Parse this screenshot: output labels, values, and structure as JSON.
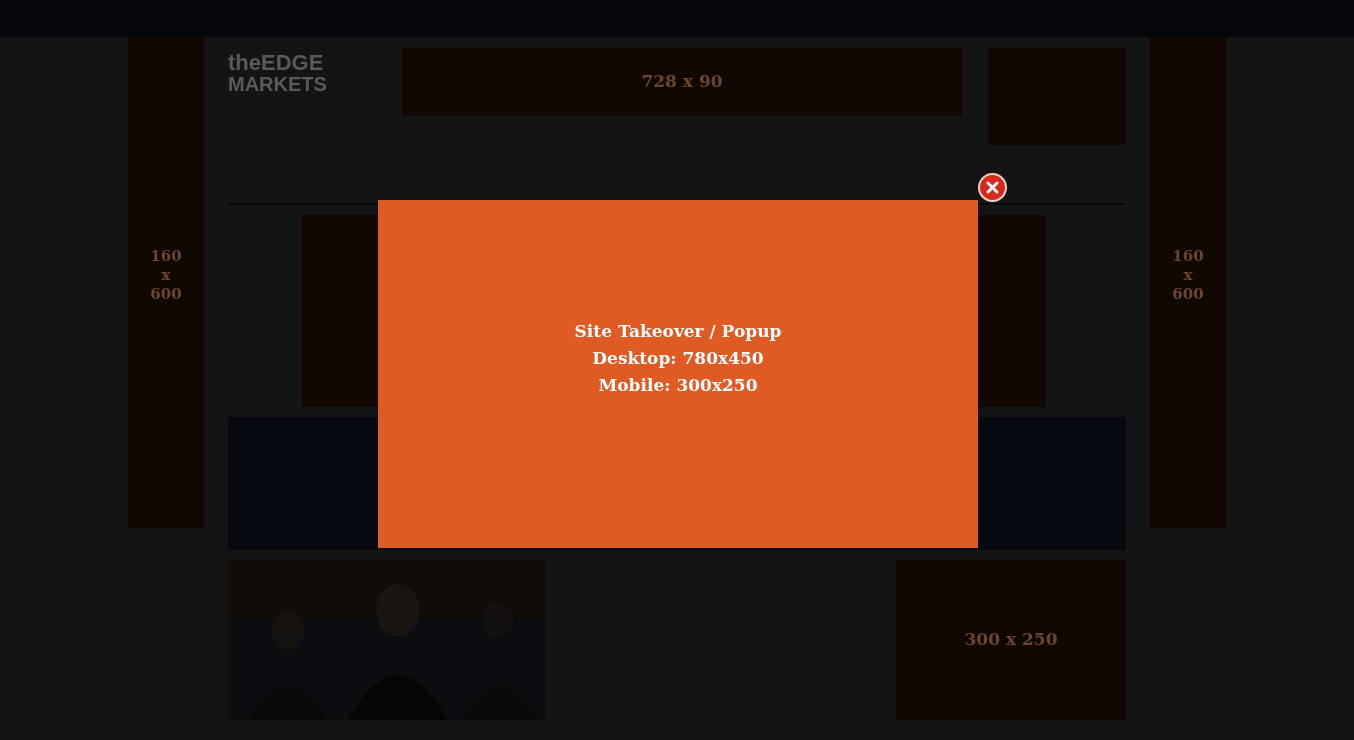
{
  "logo": {
    "line_1": "theEDGE",
    "line_2": "MARKETS"
  },
  "ads": [
    {
      "kind": "leaderboard",
      "label": "728 x 90"
    },
    {
      "kind": "skyscraper_left",
      "label": "160 x 600"
    },
    {
      "kind": "skyscraper_right",
      "label": "160 x 600"
    },
    {
      "kind": "rectangle",
      "label": "300 x 250"
    }
  ],
  "popup": {
    "lines": [
      "Site Takeover / Popup",
      "Desktop: 780x450",
      "Mobile: 300x250"
    ]
  }
}
